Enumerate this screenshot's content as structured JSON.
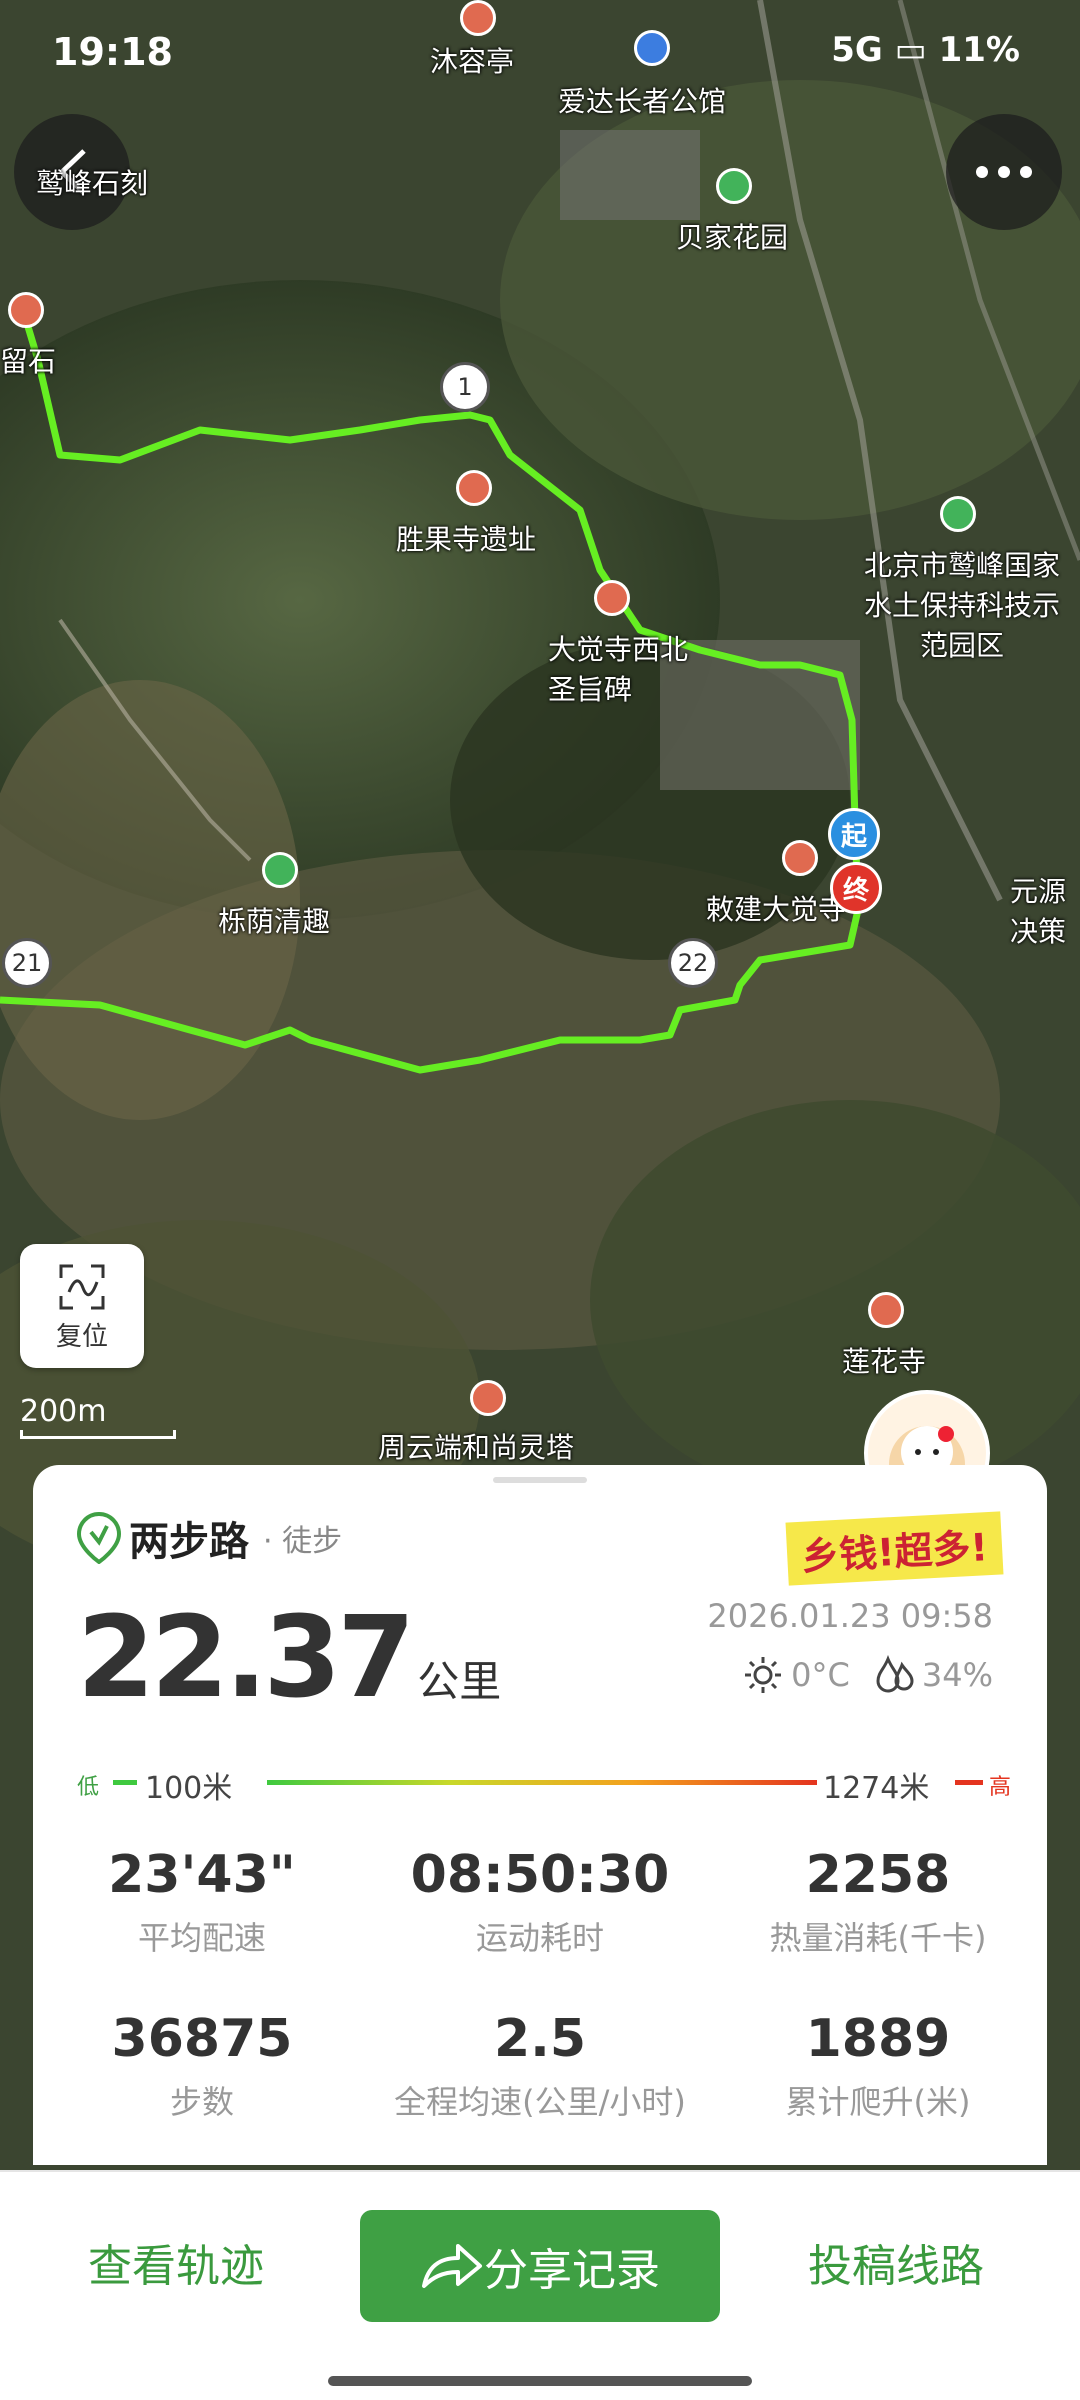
{
  "status": {
    "time": "19:18",
    "battery": "11%",
    "signal": "5G"
  },
  "map": {
    "places": [
      "沐容亭",
      "爱达长者公馆",
      "贝家花园",
      "鹫峰石刻",
      "留石",
      "胜果寺遗址",
      "大觉寺西北圣旨碑",
      "北京市鹫峰国家水土保持科技示范园区",
      "栎荫清趣",
      "敕建大觉寺",
      "元源决策",
      "莲花寺",
      "周云端和尚灵塔"
    ],
    "waypoints": [
      "1",
      "21",
      "22"
    ],
    "start_label": "起",
    "end_label": "终",
    "scale_label": "200m",
    "reset_label": "复位",
    "route_color": "#66ee22"
  },
  "card": {
    "brand": "两步路",
    "activity": "· 徒步",
    "datetime": "2026.01.23 09:58",
    "distance_value": "22.37",
    "distance_unit": "公里",
    "temperature": "0°C",
    "humidity": "34%",
    "elevation": {
      "low_tag": "低",
      "low": "100米",
      "high": "1274米",
      "high_tag": "高"
    },
    "sticker_text": "乡钱!超多!",
    "stats": [
      {
        "value": "23'43\"",
        "label": "平均配速"
      },
      {
        "value": "08:50:30",
        "label": "运动耗时"
      },
      {
        "value": "2258",
        "label": "热量消耗(千卡)"
      },
      {
        "value": "36875",
        "label": "步数"
      },
      {
        "value": "2.5",
        "label": "全程均速(公里/小时)"
      },
      {
        "value": "1889",
        "label": "累计爬升(米)"
      }
    ]
  },
  "bottom": {
    "view_track": "查看轨迹",
    "share": "分享记录",
    "submit_route": "投稿线路"
  }
}
